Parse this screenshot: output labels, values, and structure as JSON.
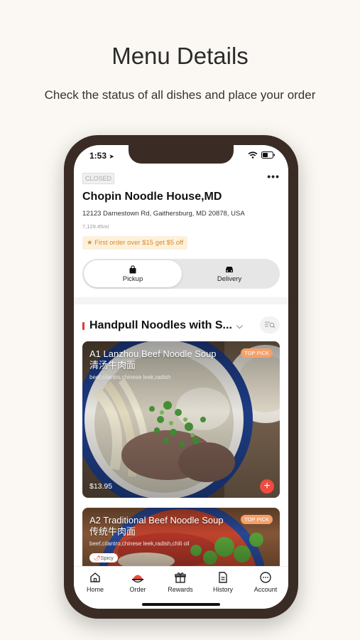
{
  "promo_screen": {
    "headline": "Menu Details",
    "subheadline": "Check the status of all dishes and place your order"
  },
  "status_bar": {
    "time": "1:53"
  },
  "restaurant": {
    "status": "CLOSED",
    "name": "Chopin Noodle House,MD",
    "address": "12123 Darnestown Rd, Gaithersburg, MD 20878, USA",
    "distance": "7,129.45mi",
    "promo": "First order over $15 get $5 off"
  },
  "order_mode": {
    "options": [
      {
        "label": "Pickup",
        "icon": "bag-icon",
        "selected": true
      },
      {
        "label": "Delivery",
        "icon": "car-icon",
        "selected": false
      }
    ]
  },
  "category": {
    "title": "Handpull Noodles with S...",
    "accent_color": "#e03a2f"
  },
  "menu_items": [
    {
      "title": "A1 Lanzhou Beef Noodle Soup",
      "title_cn": "清汤牛肉面",
      "ingredients": "beef,cilantro,chinese leek,radish",
      "badge": "TOP PICK",
      "price": "$13.95"
    },
    {
      "title": "A2 Traditional Beef Noodle Soup",
      "title_cn": "传统牛肉面",
      "ingredients": "beef,cilantro,chinese leek,radish,chili oil",
      "badge": "TOP PICK",
      "tag": "Spicy"
    }
  ],
  "tab_bar": {
    "tabs": [
      {
        "label": "Home",
        "icon": "home-icon"
      },
      {
        "label": "Order",
        "icon": "order-icon",
        "active": true
      },
      {
        "label": "Rewards",
        "icon": "rewards-icon"
      },
      {
        "label": "History",
        "icon": "history-icon"
      },
      {
        "label": "Account",
        "icon": "account-icon"
      }
    ]
  },
  "colors": {
    "background": "#fbf8f3",
    "phone_frame": "#3a2c24",
    "accent_red": "#ef4b3f",
    "promo_orange": "#d88a2a",
    "badge_orange": "#f4a06a"
  }
}
